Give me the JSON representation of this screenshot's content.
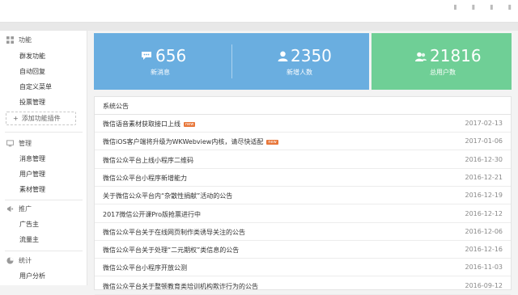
{
  "sidebar": {
    "sections": [
      {
        "title": "功能",
        "items": [
          "群发功能",
          "自动回复",
          "自定义菜单",
          "投票管理"
        ],
        "add_label": "添加功能插件"
      },
      {
        "title": "管理",
        "items": [
          "消息管理",
          "用户管理",
          "素材管理"
        ]
      },
      {
        "title": "推广",
        "items": [
          "广告主",
          "流量主"
        ]
      },
      {
        "title": "统计",
        "items": [
          "用户分析"
        ]
      }
    ]
  },
  "stats": [
    {
      "value": "656",
      "label": "新消息",
      "icon": "message-icon"
    },
    {
      "value": "2350",
      "label": "新增人数",
      "icon": "user-icon"
    },
    {
      "value": "21816",
      "label": "总用户数",
      "icon": "users-icon"
    }
  ],
  "colors": {
    "blue": "#6aaee0",
    "green": "#6fcf96",
    "badge": "#e8773a"
  },
  "notices": {
    "title": "系统公告",
    "badge_text": "new",
    "rows": [
      {
        "title": "微信语音素材获取接口上线",
        "date": "2017-02-13",
        "new": true
      },
      {
        "title": "微信iOS客户端将升级为WKWebview内核，请尽快适配",
        "date": "2017-01-06",
        "new": true
      },
      {
        "title": "微信公众平台上线小程序二维码",
        "date": "2016-12-30",
        "new": false
      },
      {
        "title": "微信公众平台小程序新增能力",
        "date": "2016-12-21",
        "new": false
      },
      {
        "title": "关于微信公众平台内“杂散性捐献”活动的公告",
        "date": "2016-12-19",
        "new": false
      },
      {
        "title": "2017微信公开课Pro版抢票进行中",
        "date": "2016-12-12",
        "new": false
      },
      {
        "title": "微信公众平台关于在线网页制作类诱导关注的公告",
        "date": "2016-12-06",
        "new": false
      },
      {
        "title": "微信公众平台关于处理“二元期权”类信息的公告",
        "date": "2016-12-16",
        "new": false
      },
      {
        "title": "微信公众平台小程序开放公测",
        "date": "2016-11-03",
        "new": false
      },
      {
        "title": "微信公众平台关于整顿教育类培训机构欺诈行为的公告",
        "date": "2016-09-12",
        "new": false
      }
    ]
  }
}
